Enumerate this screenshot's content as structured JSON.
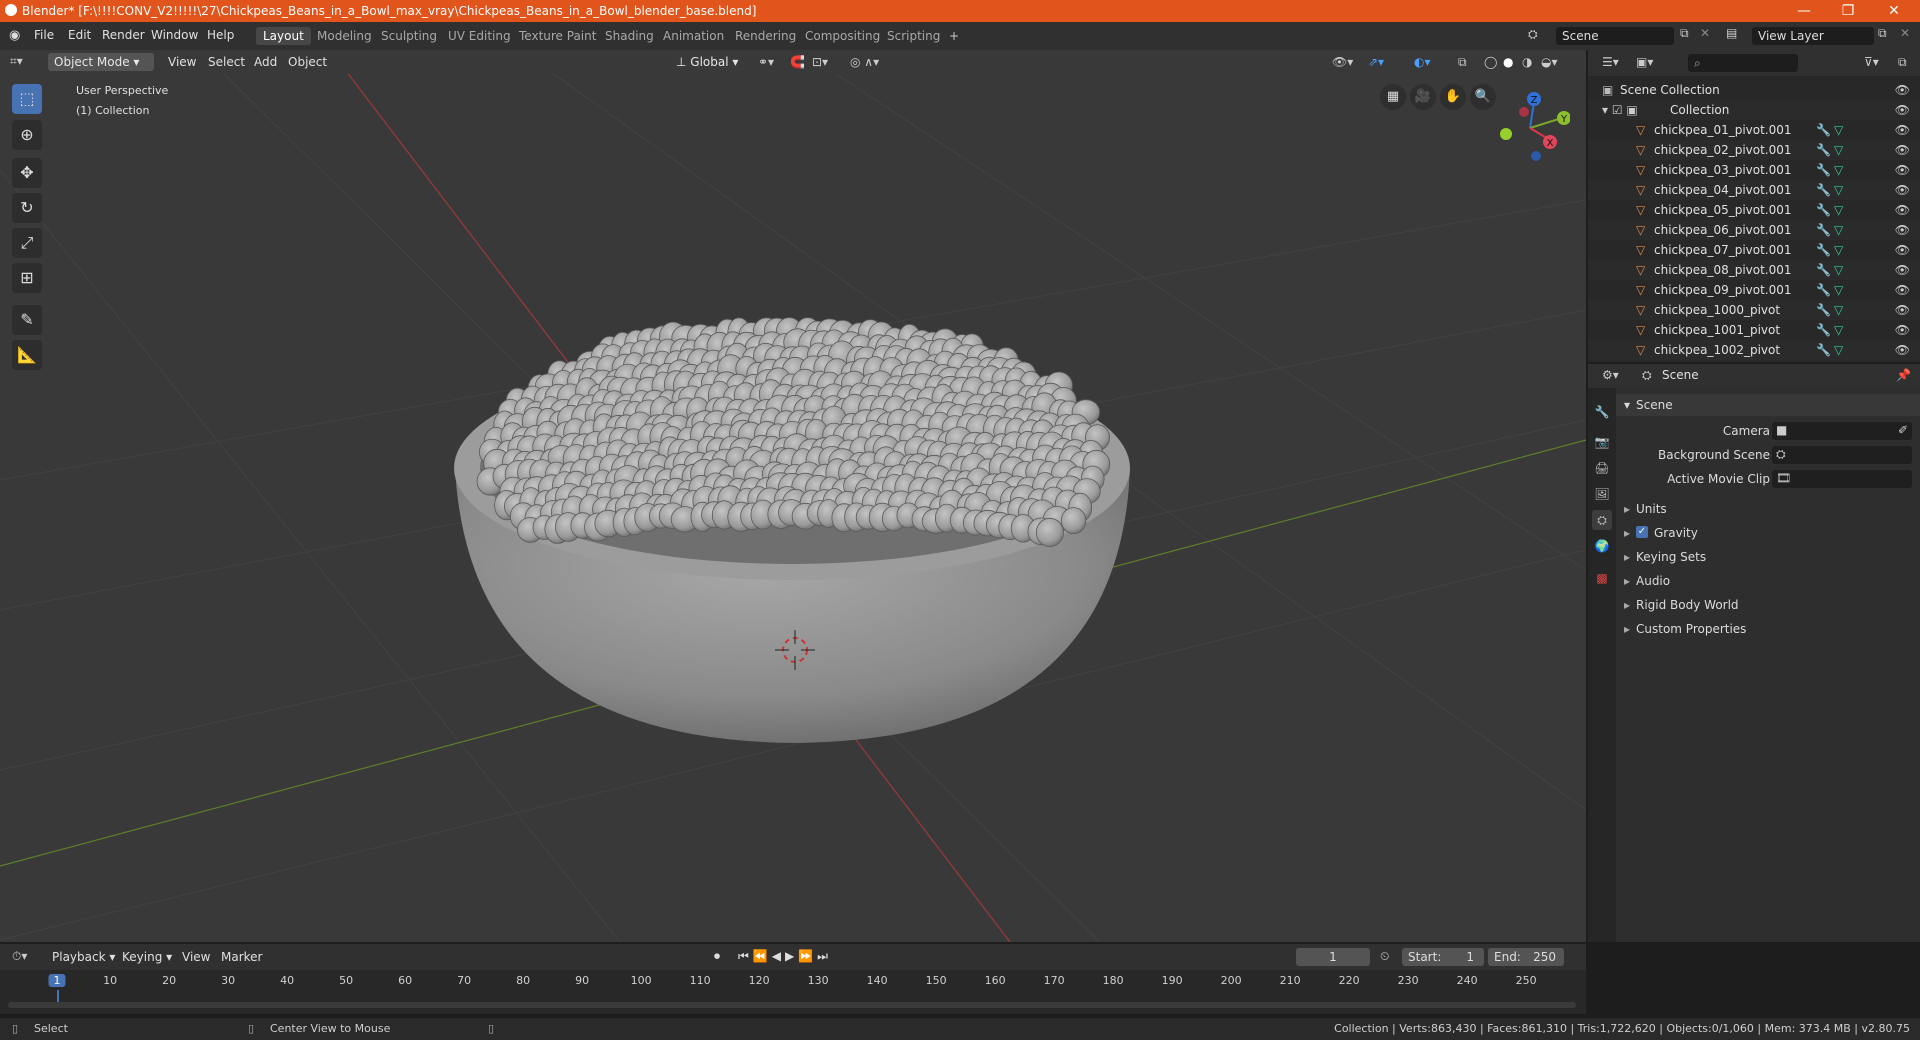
{
  "window": {
    "title": "Blender* [F:\\!!!!CONV_V2!!!!!\\27\\Chickpeas_Beans_in_a_Bowl_max_vray\\Chickpeas_Beans_in_a_Bowl_blender_base.blend]",
    "minimize": "—",
    "maximize": "❐",
    "close": "✕"
  },
  "menu": [
    "File",
    "Edit",
    "Render",
    "Window",
    "Help"
  ],
  "workspaces": [
    "Layout",
    "Modeling",
    "Sculpting",
    "UV Editing",
    "Texture Paint",
    "Shading",
    "Animation",
    "Rendering",
    "Compositing",
    "Scripting"
  ],
  "workspace_add": "+",
  "scene_field": "Scene",
  "view_layer_field": "View Layer",
  "viewport": {
    "mode": "Object Mode",
    "menus": [
      "View",
      "Select",
      "Add",
      "Object"
    ],
    "orientation": "Global",
    "view_name": "User Perspective",
    "collection_label": "(1) Collection",
    "gizmo": {
      "x": "X",
      "y": "Y",
      "z": "Z"
    }
  },
  "outliner": {
    "root": "Scene Collection",
    "collection": "Collection",
    "items": [
      "chickpea_01_pivot.001",
      "chickpea_02_pivot.001",
      "chickpea_03_pivot.001",
      "chickpea_04_pivot.001",
      "chickpea_05_pivot.001",
      "chickpea_06_pivot.001",
      "chickpea_07_pivot.001",
      "chickpea_08_pivot.001",
      "chickpea_09_pivot.001",
      "chickpea_1000_pivot",
      "chickpea_1001_pivot",
      "chickpea_1002_pivot"
    ]
  },
  "properties": {
    "context": "Scene",
    "panel": "Scene",
    "fields": [
      {
        "label": "Camera"
      },
      {
        "label": "Background Scene"
      },
      {
        "label": "Active Movie Clip"
      }
    ],
    "subpanels": [
      "Units",
      "Gravity",
      "Keying Sets",
      "Audio",
      "Rigid Body World",
      "Custom Properties"
    ],
    "gravity_checked": true
  },
  "timeline": {
    "menus": [
      "Playback",
      "Keying",
      "View",
      "Marker"
    ],
    "current_frame": "1",
    "start_label": "Start:",
    "start": "1",
    "end_label": "End:",
    "end": "250",
    "ticks": [
      "1",
      "10",
      "20",
      "30",
      "40",
      "50",
      "60",
      "70",
      "80",
      "90",
      "100",
      "110",
      "120",
      "130",
      "140",
      "150",
      "160",
      "170",
      "180",
      "190",
      "200",
      "210",
      "220",
      "230",
      "240",
      "250"
    ]
  },
  "status": {
    "left_action": "Select",
    "middle_action": "Center View to Mouse",
    "stats": "Collection | Verts:863,430 | Faces:861,310 | Tris:1,722,620 | Objects:0/1,060 | Mem: 373.4 MB | v2.80.75"
  }
}
